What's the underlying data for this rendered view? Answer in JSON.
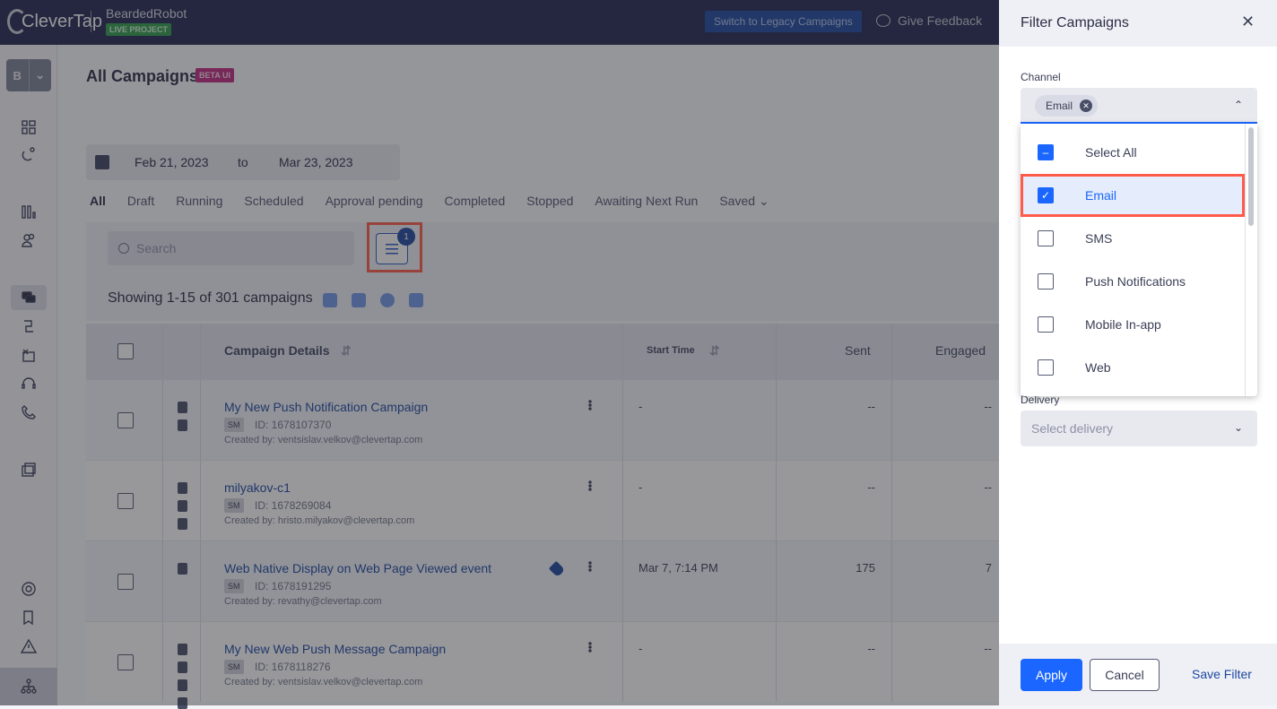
{
  "topbar": {
    "logo": "CleverTap",
    "project_name": "BeardedRobot",
    "project_badge": "LIVE PROJECT",
    "legacy_button": "Switch to Legacy Campaigns",
    "feedback": "Give Feedback"
  },
  "sidebar": {
    "project_initial": "B",
    "icons": [
      "dashboard-icon",
      "magnet-icon",
      "analytics-icon",
      "users-icon",
      "campaigns-icon",
      "journeys-icon",
      "experiments-icon",
      "support-icon",
      "call-icon",
      "templates-icon"
    ],
    "bottom_icons": [
      "settings-icon",
      "bookmark-icon",
      "alert-icon",
      "sitemap-icon"
    ]
  },
  "main": {
    "title": "All Campaigns",
    "title_badge": "BETA UI",
    "date_from": "Feb 21, 2023",
    "date_to_label": "to",
    "date_to": "Mar 23, 2023",
    "tabs": [
      "All",
      "Draft",
      "Running",
      "Scheduled",
      "Approval pending",
      "Completed",
      "Stopped",
      "Awaiting Next Run",
      "Saved"
    ],
    "active_tab": "All",
    "search_placeholder": "Search",
    "filter_count": "1",
    "showing": "Showing 1-15 of 301 campaigns",
    "columns": {
      "details": "Campaign Details",
      "start": "Start Time",
      "sent": "Sent",
      "engaged": "Engaged"
    },
    "rows": [
      {
        "name": "My New Push Notification Campaign",
        "badge": "SM",
        "id": "ID: 1678107370",
        "created": "Created by: ventsislav.velkov@clevertap.com",
        "start": "-",
        "sent": "--",
        "engaged": "--",
        "channels": [
          "mobile-icon",
          "android-icon"
        ]
      },
      {
        "name": "milyakov-c1",
        "badge": "SM",
        "id": "ID: 1678269084",
        "created": "Created by: hristo.milyakov@clevertap.com",
        "start": "-",
        "sent": "--",
        "engaged": "--",
        "channels": [
          "mobile-icon",
          "android-icon",
          "apple-icon"
        ]
      },
      {
        "name": "Web Native Display on Web Page Viewed event",
        "badge": "SM",
        "id": "ID: 1678191295",
        "created": "Created by: revathy@clevertap.com",
        "start": "Mar 7, 7:14 PM",
        "sent": "175",
        "engaged": "7",
        "channels": [
          "desktop-icon"
        ],
        "tagged": true
      },
      {
        "name": "My New Web Push Message Campaign",
        "badge": "SM",
        "id": "ID: 1678118276",
        "created": "Created by: ventsislav.velkov@clevertap.com",
        "start": "-",
        "sent": "--",
        "engaged": "--",
        "channels": [
          "desktop-icon",
          "chrome-icon",
          "firefox-icon",
          "safari-icon"
        ]
      }
    ]
  },
  "filter_panel": {
    "title": "Filter Campaigns",
    "channel_label": "Channel",
    "selected_chip": "Email",
    "options": [
      {
        "label": "Select All",
        "state": "indeterminate"
      },
      {
        "label": "Email",
        "state": "checked"
      },
      {
        "label": "SMS",
        "state": "unchecked"
      },
      {
        "label": "Push Notifications",
        "state": "unchecked"
      },
      {
        "label": "Mobile In-app",
        "state": "unchecked"
      },
      {
        "label": "Web",
        "state": "unchecked"
      }
    ],
    "delivery_label": "Delivery",
    "delivery_placeholder": "Select delivery",
    "apply": "Apply",
    "cancel": "Cancel",
    "save_filter": "Save Filter"
  }
}
